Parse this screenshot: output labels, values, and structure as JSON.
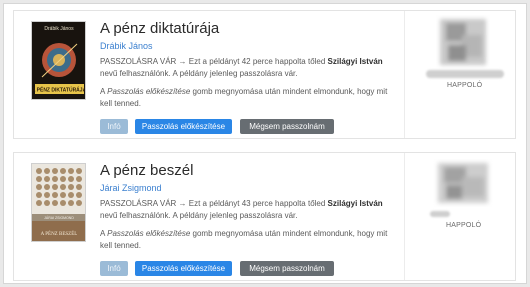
{
  "items": [
    {
      "title": "A pénz diktatúrája",
      "author": "Drábik János",
      "status_prefix": "PASSZOLÁSRA VÁR → Ezt a példányt 42 perce happolta tőled",
      "status_user": "Szilágyi István",
      "status_suffix": "nevű felhasználónk. A példány jelenleg passzolásra vár.",
      "note_prefix": "A",
      "note_italic": "Passzolás előkészítése",
      "note_suffix": "gomb megnyomása után mindent elmondunk, hogy mit kell tenned.",
      "cover_top_text": "Drábik János",
      "cover_bottom_text": "A PÉNZ DIKTATÚRÁJA",
      "handover_label": "HAPPOLÓ"
    },
    {
      "title": "A pénz beszél",
      "author": "Járai Zsigmond",
      "status_prefix": "PASSZOLÁSRA VÁR → Ezt a példányt 43 perce happolta tőled",
      "status_user": "Szilágyi István",
      "status_suffix": "nevű felhasználónk. A példány jelenleg passzolásra vár.",
      "note_prefix": "A",
      "note_italic": "Passzolás előkészítése",
      "note_suffix": "gomb megnyomása után mindent elmondunk, hogy mit kell tenned.",
      "cover_top_text": "JÁRAI ZSIGMOND",
      "cover_bottom_text": "A PÉNZ BESZÉL",
      "handover_label": "HAPPOLÓ"
    }
  ],
  "buttons": {
    "info": "Infó",
    "prepare": "Passzolás előkészítése",
    "cancel": "Mégsem passzolnám"
  },
  "colors": {
    "link": "#3a7fcf",
    "primary": "#2a86e6",
    "secondary": "#676d72",
    "info_disabled": "#9bbbd7"
  }
}
